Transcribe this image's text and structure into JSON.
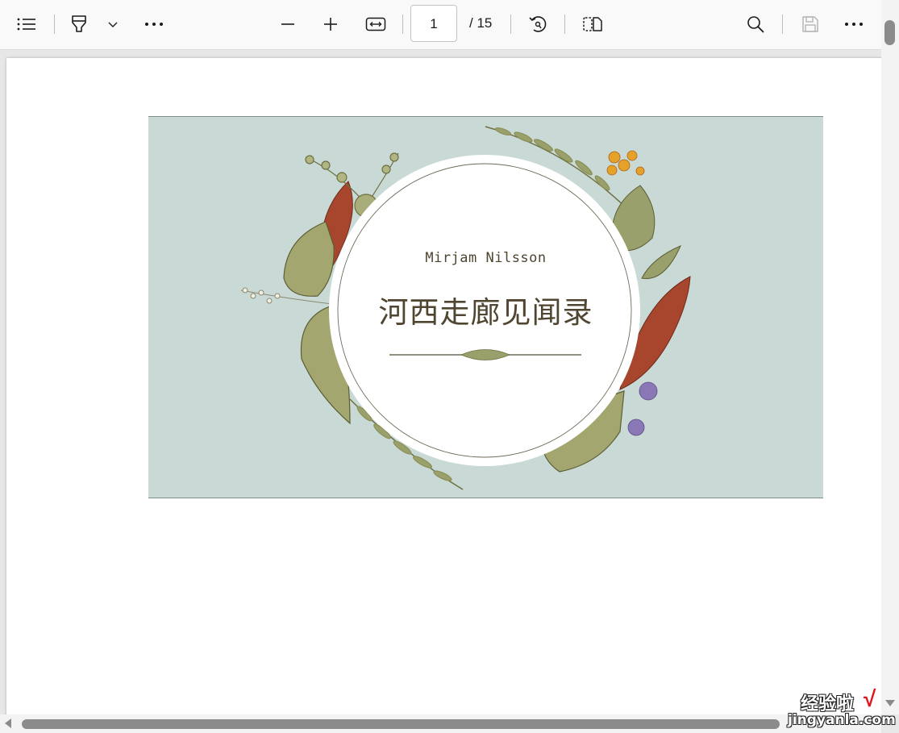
{
  "toolbar": {
    "contents_icon": "list-icon",
    "draw_icon": "highlighter-icon",
    "draw_dropdown_icon": "chevron-down-icon",
    "more_left_icon": "more-horizontal-icon",
    "zoom_out_icon": "minus-icon",
    "zoom_in_icon": "plus-icon",
    "fit_width_icon": "fit-width-icon",
    "page_number": "1",
    "page_total": "/ 15",
    "rotate_icon": "rotate-icon",
    "page_view_icon": "two-page-icon",
    "search_icon": "search-icon",
    "save_icon": "save-icon",
    "more_right_icon": "more-horizontal-icon"
  },
  "document": {
    "author": "Mirjam Nilsson",
    "title": "河西走廊见闻录",
    "colors": {
      "background": "#c9d9d6",
      "text": "#4f4530",
      "leaf_green": "#9aa06b",
      "leaf_red": "#a7462d",
      "flower_orange": "#e6a12a",
      "flower_purple": "#8a78b6"
    }
  },
  "watermark": {
    "top_text": "经验啦",
    "check": "√",
    "bottom_text": "jingyanla.com"
  }
}
